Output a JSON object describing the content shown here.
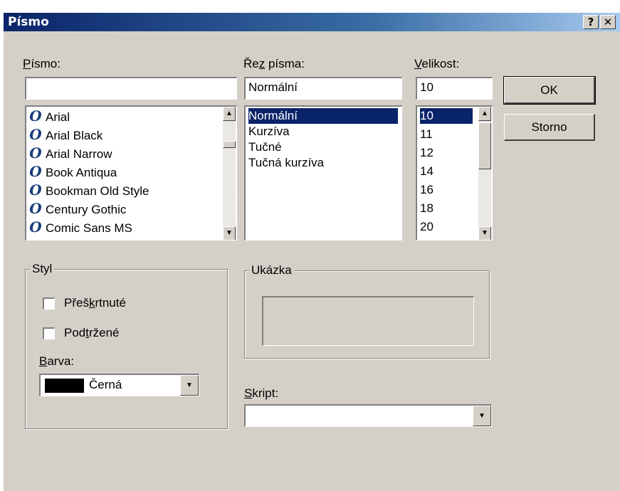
{
  "window": {
    "title": "Písmo",
    "help_label": "?",
    "close_label": "✕"
  },
  "font": {
    "label_accel": "P",
    "label_rest": "ísmo:",
    "value": "",
    "items": [
      "Arial",
      "Arial Black",
      "Arial Narrow",
      "Book Antiqua",
      "Bookman Old Style",
      "Century Gothic",
      "Comic Sans MS"
    ],
    "icon": "truetype-font-icon"
  },
  "style": {
    "label_pre": "Ře",
    "label_accel": "z",
    "label_rest": " písma:",
    "value": "Normální",
    "items": [
      "Normální",
      "Kurzíva",
      "Tučné",
      "Tučná kurzíva"
    ],
    "selected_index": 0
  },
  "size": {
    "label_accel": "V",
    "label_rest": "elikost:",
    "value": "10",
    "items": [
      "10",
      "11",
      "12",
      "14",
      "16",
      "18",
      "20"
    ],
    "selected_index": 0
  },
  "buttons": {
    "ok": "OK",
    "cancel": "Storno"
  },
  "effects": {
    "title": "Styl",
    "strike_pre": "Přeš",
    "strike_accel": "k",
    "strike_rest": "rtnuté",
    "strike_checked": false,
    "underline_pre": "Pod",
    "underline_accel": "t",
    "underline_rest": "ržené",
    "underline_checked": false,
    "color_label_accel": "B",
    "color_label_rest": "arva:",
    "color_value": "Černá",
    "color_swatch": "#000000"
  },
  "sample": {
    "title": "Ukázka",
    "text": ""
  },
  "script": {
    "label_accel": "S",
    "label_rest": "kript:",
    "value": ""
  },
  "colors": {
    "face": "#d4d0c8",
    "title_start": "#0a246a",
    "selection": "#0a246a"
  }
}
